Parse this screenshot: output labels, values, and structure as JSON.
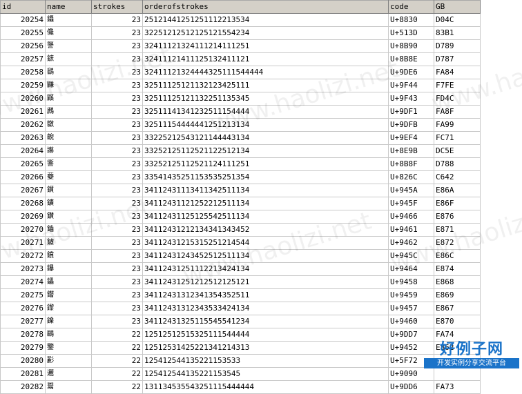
{
  "columns": [
    "id",
    "name",
    "strokes",
    "orderofstrokes",
    "code",
    "GB"
  ],
  "rows": [
    [
      "20254",
      "鑷",
      "23",
      "25121441251251112213534",
      "U+8830",
      "D04C"
    ],
    [
      "20255",
      "儳",
      "23",
      "32251212512125121554234",
      "U+513D",
      "83B1"
    ],
    [
      "20256",
      "讋",
      "23",
      "32411121324111214111251",
      "U+8B90",
      "D789"
    ],
    [
      "20257",
      "鏣",
      "23",
      "32411121411125132411121",
      "U+8B8E",
      "D787"
    ],
    [
      "20258",
      "鷂",
      "23",
      "32411121324444325111544444",
      "U+9DE6",
      "FA84"
    ],
    [
      "20259",
      "鼸",
      "23",
      "32511125121132123425111",
      "U+9F44",
      "F7FE"
    ],
    [
      "20260",
      "鼷",
      "23",
      "32511125121132251135345",
      "U+9F43",
      "FD4C"
    ],
    [
      "20261",
      "鷉",
      "23",
      "32511141341232511154444",
      "U+9DF1",
      "FA8F"
    ],
    [
      "20262",
      "鷻",
      "23",
      "32511154444441251213134",
      "U+9DFB",
      "FA99"
    ],
    [
      "20263",
      "齯",
      "23",
      "33225212543121144443134",
      "U+9EF4",
      "FC71"
    ],
    [
      "20264",
      "讛",
      "23",
      "33252125112521122512134",
      "U+8E9B",
      "DC5E"
    ],
    [
      "20265",
      "讏",
      "23",
      "33252125112521124111251",
      "U+8B8F",
      "D788"
    ],
    [
      "20266",
      "虁",
      "23",
      "33541435251153535251354",
      "U+826C",
      "C642"
    ],
    [
      "20267",
      "鑕",
      "23",
      "34112431113411342511134",
      "U+945A",
      "E86A"
    ],
    [
      "20268",
      "鑛",
      "23",
      "34112431121252212511134",
      "U+945F",
      "E86F"
    ],
    [
      "20269",
      "鑚",
      "23",
      "34112431125125542511134",
      "U+9466",
      "E876"
    ],
    [
      "20270",
      "鑡",
      "23",
      "34112431212134341343452",
      "U+9461",
      "E871"
    ],
    [
      "20271",
      "鑢",
      "23",
      "34112431215315251214544",
      "U+9462",
      "E872"
    ],
    [
      "20272",
      "鑜",
      "23",
      "34112431243452512511134",
      "U+945C",
      "E86C"
    ],
    [
      "20273",
      "鑤",
      "23",
      "34112431251112213424134",
      "U+9464",
      "E874"
    ],
    [
      "20274",
      "鑘",
      "23",
      "34112431251212512125121",
      "U+9458",
      "E868"
    ],
    [
      "20275",
      "鑙",
      "23",
      "34112431312341354352511",
      "U+9459",
      "E869"
    ],
    [
      "20276",
      "鑗",
      "23",
      "34112431312343533424134",
      "U+9457",
      "E867"
    ],
    [
      "20277",
      "鑠",
      "23",
      "34112431325115545541234",
      "U+9460",
      "E870"
    ],
    [
      "20278",
      "鷗",
      "22",
      "12512512515325111544444",
      "U+9DD7",
      "FA74"
    ],
    [
      "20279",
      "鑒",
      "22",
      "12512531425221341214313",
      "U+9452",
      "E862"
    ],
    [
      "20280",
      "彲",
      "22",
      "125412544135221153533",
      "U+5F72",
      ""
    ],
    [
      "20281",
      "邐",
      "22",
      "125412544135221153545",
      "U+9090",
      ""
    ],
    [
      "20282",
      "鬻",
      "22",
      "131134535543251115444444",
      "U+9DD6",
      "FA73"
    ]
  ],
  "watermark": "www.haolizi.net",
  "logo": {
    "title": "好例子网",
    "subtitle": "开发实例分享交流平台"
  }
}
